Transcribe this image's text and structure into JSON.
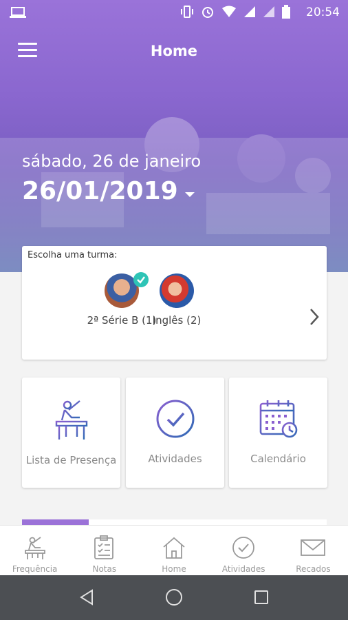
{
  "status_bar": {
    "time": "20:54"
  },
  "app_bar": {
    "title": "Home"
  },
  "date": {
    "long": "sábado, 26 de janeiro",
    "short": "26/01/2019"
  },
  "class_selector": {
    "title": "Escolha uma turma:",
    "classes": [
      {
        "label": "2ª Série B (1)",
        "selected": true
      },
      {
        "label": "Inglês (2)",
        "selected": false
      }
    ]
  },
  "tiles": [
    {
      "label": "Lista de Presença",
      "icon": "desk-student-icon"
    },
    {
      "label": "Atividades",
      "icon": "check-circle-icon"
    },
    {
      "label": "Calendário",
      "icon": "calendar-clock-icon"
    }
  ],
  "progress": {
    "value": 0.22
  },
  "bottom_nav": [
    {
      "label": "Frequência",
      "icon": "desk-student-icon"
    },
    {
      "label": "Notas",
      "icon": "clipboard-icon"
    },
    {
      "label": "Home",
      "icon": "home-icon"
    },
    {
      "label": "Atividades",
      "icon": "check-circle-icon"
    },
    {
      "label": "Recados",
      "icon": "mail-icon"
    }
  ],
  "colors": {
    "accent": "#9b72d8",
    "tile_icon_start": "#2f6bb5",
    "tile_icon_end": "#8a5fd0",
    "check": "#2ec4b6"
  }
}
